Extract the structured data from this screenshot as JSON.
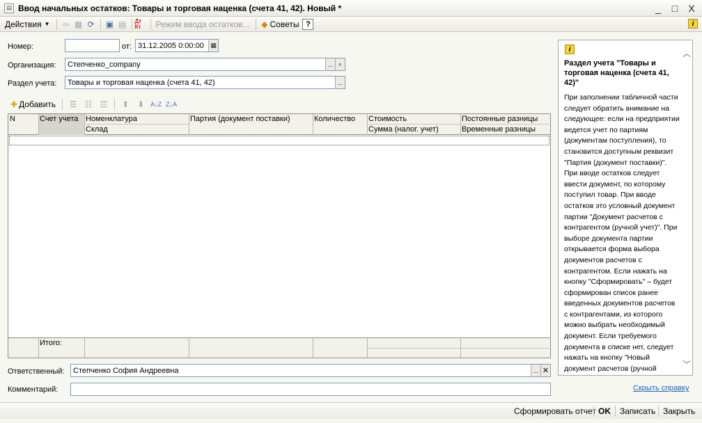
{
  "window": {
    "title": "Ввод начальных остатков: Товары и торговая наценка (счета 41, 42). Новый *",
    "controls": [
      "_",
      "□",
      "X"
    ]
  },
  "toolbar": {
    "actions_label": "Действия",
    "mode_label": "Режим ввода остатков...",
    "dtkt_label": "Дт Кт",
    "advice_label": "Советы",
    "help_label": "?",
    "info_label": "i"
  },
  "form": {
    "number_label": "Номер:",
    "number_value": "",
    "date_label": "от:",
    "date_value": "31.12.2005  0:00:00",
    "org_label": "Организация:",
    "org_value": "Степченко_company",
    "section_label": "Раздел учета:",
    "section_value": "Товары и торговая наценка (счета 41, 42)",
    "select_btn": "...",
    "search_icon_label": "search-icon"
  },
  "table_toolbar": {
    "add_label": "Добавить"
  },
  "table": {
    "headers": {
      "n": "N",
      "account": "Счет учета",
      "nomenclature": "Номенклатура",
      "warehouse": "Склад",
      "batch": "Партия (документ поставки)",
      "quantity": "Количество",
      "cost": "Стоимость",
      "tax_sum": "Сумма (налог. учет)",
      "permanent_diff": "Постоянные разницы",
      "temporary_diff": "Временные разницы"
    },
    "rows": [],
    "total_label": "Итого:"
  },
  "bottom": {
    "responsible_label": "Ответственный:",
    "responsible_value": "Степченко София Андреевна",
    "comment_label": "Комментарий:",
    "comment_value": "",
    "select_btn": "...",
    "clear_btn": "✕"
  },
  "help": {
    "icon_label": "i",
    "title": "Раздел учета \"Товары и торговая наценка (счета 41, 42)\"",
    "body": "При заполнении табличной части следует обратить внимание на следующее: если на предприятии ведется учет по партиям (документам поступления), то становится доступным реквизит \"Партия (документ поставки)\". При вводе остатков следует ввести документ, по которому поступил товар. При вводе остатков это условный документ партии \"Документ расчетов с контрагентом (ручной учет)\". При выборе документа партии открывается форма выбора документов расчетов с контрагентом. Если нажать на кнопку \"Сформировать\" – будет сформирован список ранее введенных документов расчетов с контрагентами, из которого можно выбрать необходимый документ. Если требуемого документа в списке нет, следует нажать на кнопку \"Новый документ расчетов (ручной учет)\". В открывшейся форме документа расчетов",
    "hide_link": "Скрыть справку"
  },
  "footer_buttons": {
    "report": "Сформировать отчет",
    "ok": "OK",
    "save": "Записать",
    "close": "Закрыть"
  }
}
